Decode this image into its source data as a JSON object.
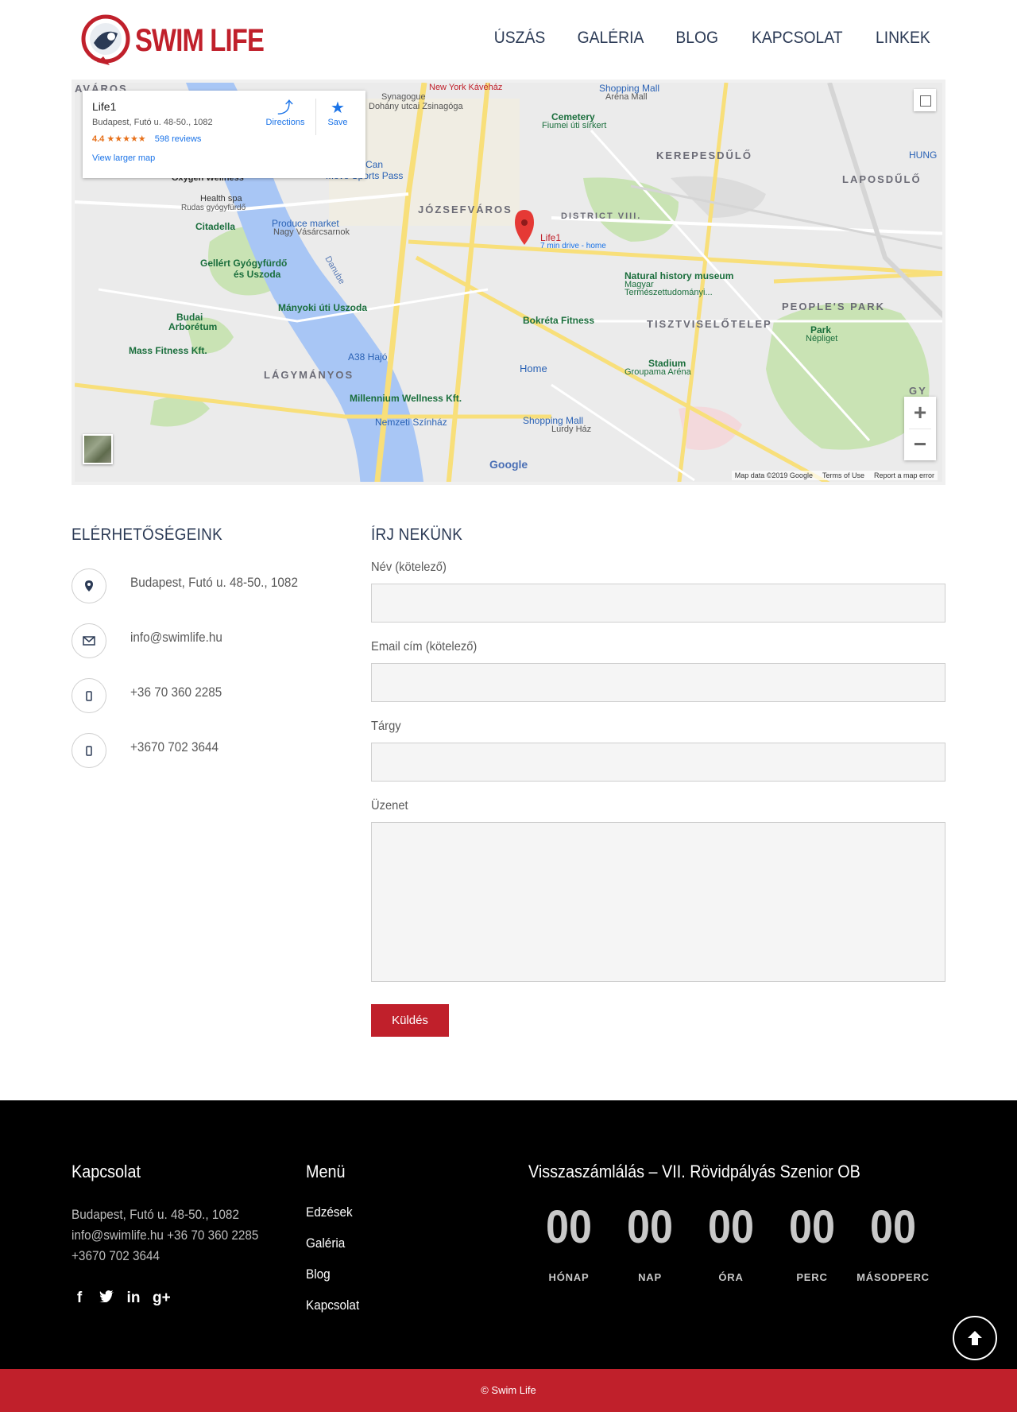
{
  "header": {
    "logo_text": "SWIM LIFE",
    "nav": [
      "ÚSZÁS",
      "GALÉRIA",
      "BLOG",
      "KAPCSOLAT",
      "LINKEK"
    ]
  },
  "map": {
    "card": {
      "title": "Life1",
      "address": "Budapest, Futó u. 48-50., 1082",
      "rating": "4.4",
      "stars": "★★★★★",
      "reviews": "598 reviews",
      "view_larger": "View larger map",
      "directions": "Directions",
      "save": "Save"
    },
    "labels": {
      "varos": "AVÁROS",
      "new_york": "New York Kávéház",
      "shopping_arena": "Shopping Mall",
      "arena_mall": "Aréna Mall",
      "synagogue1": "Synagogue",
      "synagogue2": "Dohány utcai Zsinagóga",
      "cemetery": "Cemetery",
      "cemetery2": "Fiumei úti sírkert",
      "kerepesdulo": "KEREPESDŰLŐ",
      "hung": "HUNG",
      "lapos": "LAPOSDŰLŐ",
      "all_you_can": "All You Can",
      "move_sports": "Move Sports Pass",
      "oxygen": "Oxygen Wellness",
      "health_spa": "Health spa",
      "rudas": "Rudas gyógyfürdő",
      "jozsefvaros": "JÓZSEFVÁROS",
      "district": "DISTRICT VIII.",
      "citadella": "Citadella",
      "produce": "Produce market",
      "nagy": "Nagy Vásárcsarnok",
      "life1": "Life1",
      "life1_sub": "7 min drive - home",
      "gellert": "Gellért Gyógyfürdő",
      "gellert2": "és Uszoda",
      "natural": "Natural history museum",
      "magyar": "Magyar",
      "termesz": "Természettudományi...",
      "peoples": "PEOPLE'S PARK",
      "manyoki": "Mányoki úti Uszoda",
      "budai": "Budai",
      "arboretum": "Arborétum",
      "bokreta": "Bokréta Fitness",
      "tisztviselo": "TISZTVISELŐTELEP",
      "park": "Park",
      "nepliget": "Népliget",
      "mass": "Mass Fitness Kft.",
      "a38": "A38 Hajó",
      "home": "Home",
      "stadium": "Stadium",
      "groupama": "Groupama Aréna",
      "lagymanyos": "LÁGYMÁNYOS",
      "millennium": "Millennium Wellness Kft.",
      "nemzeti": "Nemzeti Színház",
      "shopping_lurdy": "Shopping Mall",
      "lurdy": "Lurdy Ház",
      "danube": "Danube",
      "gy": "GY"
    },
    "google": "Google",
    "footer": [
      "Map data ©2019 Google",
      "Terms of Use",
      "Report a map error"
    ]
  },
  "contact": {
    "title": "ELÉRHETŐSÉGEINK",
    "items": [
      {
        "icon": "location-icon",
        "text": "Budapest, Futó u. 48-50., 1082"
      },
      {
        "icon": "envelope-icon",
        "text": "info@swimlife.hu"
      },
      {
        "icon": "phone-icon",
        "text": "+36 70 360 2285"
      },
      {
        "icon": "phone-icon",
        "text": "+3670 702 3644"
      }
    ]
  },
  "form": {
    "title": "ÍRJ NEKÜNK",
    "name_label": "Név (kötelező)",
    "email_label": "Email cím (kötelező)",
    "subject_label": "Tárgy",
    "message_label": "Üzenet",
    "submit": "Küldés"
  },
  "footer": {
    "contact_title": "Kapcsolat",
    "contact_lines": [
      "Budapest, Futó u. 48-50., 1082",
      "info@swimlife.hu +36 70 360 2285",
      "+3670 702 3644"
    ],
    "social": [
      "facebook-icon",
      "twitter-icon",
      "linkedin-icon",
      "google-plus-icon"
    ],
    "menu_title": "Menü",
    "menu": [
      "Edzések",
      "Galéria",
      "Blog",
      "Kapcsolat"
    ],
    "countdown_title": "Visszaszámlálás – VII. Rövidpályás Szenior OB",
    "countdown": [
      {
        "value": "00",
        "label": "HÓNAP"
      },
      {
        "value": "00",
        "label": "NAP"
      },
      {
        "value": "00",
        "label": "ÓRA"
      },
      {
        "value": "00",
        "label": "PERC"
      },
      {
        "value": "00",
        "label": "MÁSODPERC"
      }
    ],
    "copyright": "© Swim Life"
  }
}
